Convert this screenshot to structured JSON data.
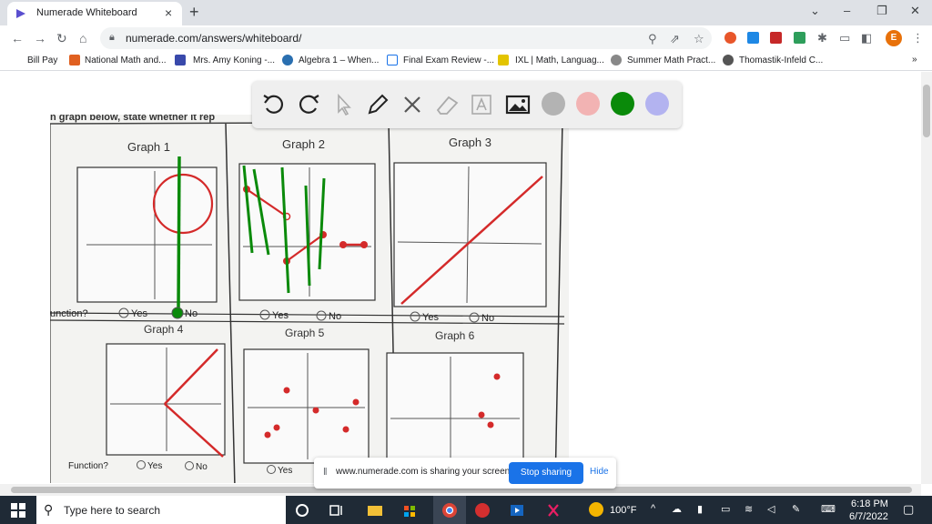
{
  "browser": {
    "tab_title": "Numerade Whiteboard",
    "new_tab_glyph": "+",
    "close_glyph": "×",
    "url": "numerade.com/answers/whiteboard/",
    "profile_initial": "E"
  },
  "bookmarks": [
    {
      "label": "Bill Pay",
      "icon": "none"
    },
    {
      "label": "National Math and...",
      "icon": "math-icon"
    },
    {
      "label": "Mrs. Amy Koning -...",
      "icon": "page-icon"
    },
    {
      "label": "Algebra 1 – When...",
      "icon": "wordpress-icon"
    },
    {
      "label": "Final Exam Review -...",
      "icon": "doc-icon"
    },
    {
      "label": "IXL | Math, Languag...",
      "icon": "ixl-icon"
    },
    {
      "label": "Summer Math Pract...",
      "icon": "globe-icon"
    },
    {
      "label": "Thomastik-Infeld C...",
      "icon": "globe-icon"
    }
  ],
  "whiteboard": {
    "tools": [
      "undo-icon",
      "redo-icon",
      "pointer-icon",
      "pen-icon",
      "shapes-icon",
      "eraser-icon",
      "text-icon",
      "image-icon"
    ],
    "colors": [
      "#b3b3b3",
      "#f2b3b3",
      "#0a8a0a",
      "#b3b3f0"
    ]
  },
  "worksheet": {
    "header_fragment": "n graph below, state whether it rep",
    "graphs": [
      {
        "title": "Graph 1",
        "question": "unction?",
        "yes": "Yes",
        "no": "No",
        "selected": "No"
      },
      {
        "title": "Graph 2",
        "yes": "Yes",
        "no": "No"
      },
      {
        "title": "Graph 3",
        "yes": "Yes",
        "no": "No"
      },
      {
        "title": "Graph 4",
        "question": "Function?",
        "yes": "Yes",
        "no": "No"
      },
      {
        "title": "Graph 5",
        "yes": "Yes"
      },
      {
        "title": "Graph 6"
      }
    ]
  },
  "share_bar": {
    "message": "www.numerade.com is sharing your screen.",
    "stop_label": "Stop sharing",
    "hide_label": "Hide"
  },
  "taskbar": {
    "search_placeholder": "Type here to search",
    "temperature": "100°F",
    "time": "6:18 PM",
    "date": "6/7/2022"
  },
  "colors": {
    "brand_accent": "#1a73e8",
    "drawing_green": "#0a8a0a",
    "graph_red": "#d42a2a"
  }
}
